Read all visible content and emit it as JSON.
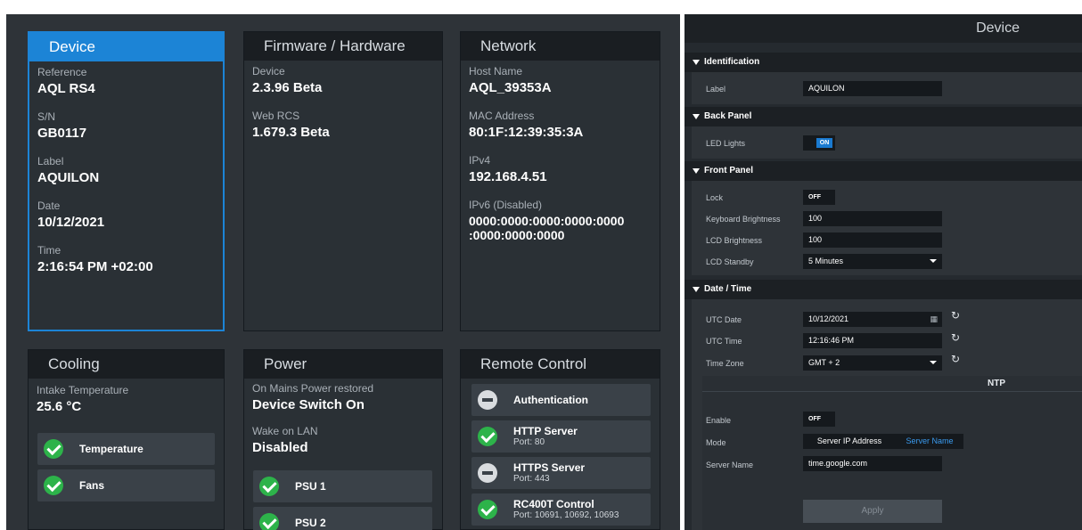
{
  "cards": {
    "device": {
      "title": "Device",
      "fields": [
        {
          "label": "Reference",
          "value": "AQL RS4"
        },
        {
          "label": "S/N",
          "value": "GB0117"
        },
        {
          "label": "Label",
          "value": "AQUILON"
        },
        {
          "label": "Date",
          "value": "10/12/2021"
        },
        {
          "label": "Time",
          "value": "2:16:54 PM +02:00"
        }
      ]
    },
    "firmware": {
      "title": "Firmware / Hardware",
      "fields": [
        {
          "label": "Device",
          "value": "2.3.96 Beta"
        },
        {
          "label": "Web RCS",
          "value": "1.679.3 Beta"
        }
      ]
    },
    "network": {
      "title": "Network",
      "fields": [
        {
          "label": "Host Name",
          "value": "AQL_39353A"
        },
        {
          "label": "MAC Address",
          "value": "80:1F:12:39:35:3A"
        },
        {
          "label": "IPv4",
          "value": "192.168.4.51"
        },
        {
          "label": "IPv6 (Disabled)",
          "value_line1": "0000:0000:0000:0000:0000",
          "value_line2": ":0000:0000:0000"
        }
      ]
    },
    "cooling": {
      "title": "Cooling",
      "label": "Intake Temperature",
      "value": "25.6 °C",
      "tiles": [
        {
          "label": "Temperature",
          "status": "ok"
        },
        {
          "label": "Fans",
          "status": "ok"
        }
      ]
    },
    "power": {
      "title": "Power",
      "fields": [
        {
          "label": "On Mains Power restored",
          "value": "Device Switch On"
        },
        {
          "label": "Wake on LAN",
          "value": "Disabled"
        }
      ],
      "tiles": [
        {
          "label": "PSU 1",
          "status": "ok"
        },
        {
          "label": "PSU 2",
          "status": "ok"
        }
      ]
    },
    "remote": {
      "title": "Remote Control",
      "tiles": [
        {
          "label": "Authentication",
          "status": "disabled"
        },
        {
          "label": "HTTP Server",
          "sub": "Port: 80",
          "status": "ok"
        },
        {
          "label": "HTTPS Server",
          "sub": "Port: 443",
          "status": "disabled"
        },
        {
          "label": "RC400T Control",
          "sub": "Port: 10691, 10692, 10693",
          "status": "ok"
        }
      ]
    }
  },
  "panel": {
    "title": "Device",
    "identification": {
      "header": "Identification",
      "label_label": "Label",
      "label_value": "AQUILON"
    },
    "back_panel": {
      "header": "Back Panel",
      "led_label": "LED Lights",
      "led_value": "ON"
    },
    "front_panel": {
      "header": "Front Panel",
      "lock_label": "Lock",
      "lock_value": "OFF",
      "kb_label": "Keyboard Brightness",
      "kb_value": "100",
      "lcd_label": "LCD Brightness",
      "lcd_value": "100",
      "standby_label": "LCD Standby",
      "standby_value": "5 Minutes"
    },
    "datetime": {
      "header": "Date / Time",
      "date_label": "UTC Date",
      "date_value": "10/12/2021",
      "time_label": "UTC Time",
      "time_value": "12:16:46 PM",
      "tz_label": "Time Zone",
      "tz_value": "GMT + 2"
    },
    "ntp": {
      "header": "NTP",
      "enable_label": "Enable",
      "enable_value": "OFF",
      "mode_label": "Mode",
      "mode_options": [
        "Server IP Address",
        "Server Name"
      ],
      "mode_selected": "Server Name",
      "server_label": "Server Name",
      "server_value": "time.google.com",
      "apply_label": "Apply"
    }
  },
  "colors": {
    "accent": "#1c84d6",
    "ok": "#2db34a",
    "card_bg": "#2a3035",
    "panel_bg": "#252a2f"
  }
}
